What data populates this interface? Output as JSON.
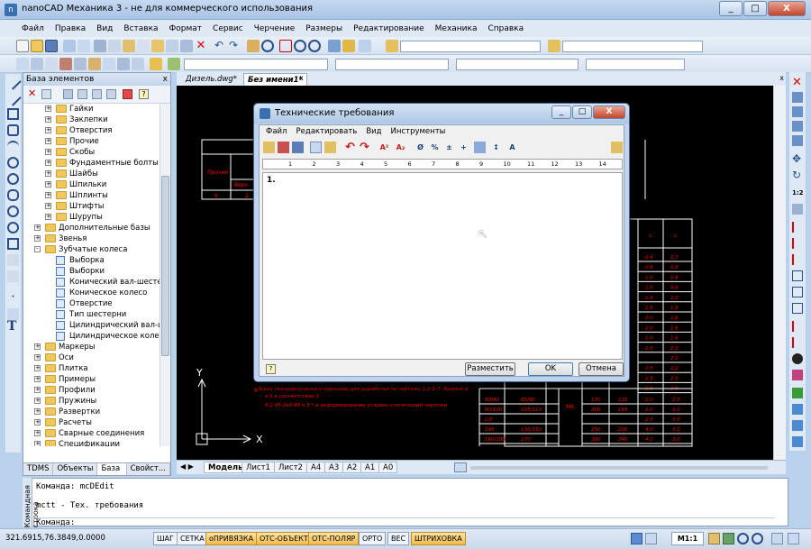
{
  "window": {
    "title": "nanoCAD Механика 3 - не для коммерческого использования",
    "min": "_",
    "max": "□",
    "close": "X"
  },
  "menu": [
    "Файл",
    "Правка",
    "Вид",
    "Вставка",
    "Формат",
    "Сервис",
    "Черчение",
    "Размеры",
    "Редактирование",
    "Механика",
    "Справка"
  ],
  "panel": {
    "title": "База элементов",
    "close": "x",
    "tree": [
      {
        "label": "Гайки",
        "level": 2,
        "type": "folder",
        "exp": "+"
      },
      {
        "label": "Заклепки",
        "level": 2,
        "type": "folder",
        "exp": "+"
      },
      {
        "label": "Отверстия",
        "level": 2,
        "type": "folder",
        "exp": "+"
      },
      {
        "label": "Прочие",
        "level": 2,
        "type": "folder",
        "exp": "+"
      },
      {
        "label": "Скобы",
        "level": 2,
        "type": "folder",
        "exp": "+"
      },
      {
        "label": "Фундаментные болты",
        "level": 2,
        "type": "folder",
        "exp": "+"
      },
      {
        "label": "Шайбы",
        "level": 2,
        "type": "folder",
        "exp": "+"
      },
      {
        "label": "Шпильки",
        "level": 2,
        "type": "folder",
        "exp": "+"
      },
      {
        "label": "Шплинты",
        "level": 2,
        "type": "folder",
        "exp": "+"
      },
      {
        "label": "Штифты",
        "level": 2,
        "type": "folder",
        "exp": "+"
      },
      {
        "label": "Шурупы",
        "level": 2,
        "type": "folder",
        "exp": "+"
      },
      {
        "label": "Дополнительные базы",
        "level": 1,
        "type": "folder",
        "exp": "+"
      },
      {
        "label": "Звенья",
        "level": 1,
        "type": "folder",
        "exp": "+"
      },
      {
        "label": "Зубчатые колеса",
        "level": 1,
        "type": "folder",
        "exp": "-"
      },
      {
        "label": "Выборка",
        "level": 2,
        "type": "doc",
        "exp": ""
      },
      {
        "label": "Выборки",
        "level": 2,
        "type": "doc",
        "exp": ""
      },
      {
        "label": "Конический вал-шестерн",
        "level": 2,
        "type": "doc",
        "exp": ""
      },
      {
        "label": "Коническое колесо",
        "level": 2,
        "type": "doc",
        "exp": ""
      },
      {
        "label": "Отверстие",
        "level": 2,
        "type": "doc",
        "exp": ""
      },
      {
        "label": "Тип шестерни",
        "level": 2,
        "type": "doc",
        "exp": ""
      },
      {
        "label": "Цилиндрический вал-шес",
        "level": 2,
        "type": "doc",
        "exp": ""
      },
      {
        "label": "Цилиндрическое колесо",
        "level": 2,
        "type": "doc",
        "exp": ""
      },
      {
        "label": "Маркеры",
        "level": 1,
        "type": "folder",
        "exp": "+"
      },
      {
        "label": "Оси",
        "level": 1,
        "type": "folder",
        "exp": "+"
      },
      {
        "label": "Плитка",
        "level": 1,
        "type": "folder",
        "exp": "+"
      },
      {
        "label": "Примеры",
        "level": 1,
        "type": "folder",
        "exp": "+"
      },
      {
        "label": "Профили",
        "level": 1,
        "type": "folder",
        "exp": "+"
      },
      {
        "label": "Пружины",
        "level": 1,
        "type": "folder",
        "exp": "+"
      },
      {
        "label": "Развертки",
        "level": 1,
        "type": "folder",
        "exp": "+"
      },
      {
        "label": "Расчеты",
        "level": 1,
        "type": "folder",
        "exp": "+"
      },
      {
        "label": "Сварные соединения",
        "level": 1,
        "type": "folder",
        "exp": "+"
      },
      {
        "label": "Спецификации",
        "level": 1,
        "type": "folder",
        "exp": "+"
      }
    ],
    "tabs": [
      "TDMS",
      "Объекты",
      "База эл...",
      "Свойст..."
    ]
  },
  "doc_tabs": [
    "Дизель.dwg*",
    "Без имени1*"
  ],
  "doc_tab_close": "x",
  "layout_tabs": [
    "Модель",
    "Лист1",
    "Лист2",
    "A4",
    "A3",
    "A2",
    "A1",
    "A0"
  ],
  "dialog": {
    "title": "Технические требования",
    "menu": [
      "Файл",
      "Редактировать",
      "Вид",
      "Инструменты"
    ],
    "ruler": [
      "1",
      "2",
      "3",
      "4",
      "5",
      "6",
      "7",
      "8",
      "9",
      "10",
      "11",
      "12",
      "13",
      "14"
    ],
    "editor_first_line": "1.",
    "buttons": {
      "place": "Разместить",
      "ok": "OK",
      "cancel": "Отмена"
    },
    "help_glyph": "?"
  },
  "command": {
    "side_label": "Командная строка",
    "lines": [
      "Команда: mcDEdit",
      "mctt - Тех. требования",
      "Команда:"
    ]
  },
  "status": {
    "coords": "321.6915,76.3849,0.0000",
    "toggles": [
      {
        "label": "ШАГ",
        "on": false
      },
      {
        "label": "СЕТКА",
        "on": false
      },
      {
        "label": "оПРИВЯЗКА",
        "on": true
      },
      {
        "label": "ОТС-ОБЪЕКТ",
        "on": true
      },
      {
        "label": "ОТС-ПОЛЯР",
        "on": true
      },
      {
        "label": "ОРТО",
        "on": false
      },
      {
        "label": "ВЕС",
        "on": false
      },
      {
        "label": "ШТРИХОВКА",
        "on": true
      }
    ],
    "scale": "M1:1"
  },
  "canvas": {
    "axis_x": "X",
    "axis_y": "Y",
    "note_lines": [
      "Эскиз технологического перехода для доработки по чертежу 1-2-1-7: Кромки и",
      "в 3 к соответствии 1",
      "В.2 45-2к9-98 п.5 * и деформирование условно статический чертежи"
    ],
    "table_a": [
      [
        "80/90",
        "85/95"
      ],
      [
        "90/100",
        "105/110"
      ],
      [
        "1/5",
        ""
      ],
      [
        "140",
        "130/150"
      ],
      [
        "160/180",
        "170"
      ]
    ],
    "table_b": [
      [
        "170",
        "130",
        "2.0",
        "2.5"
      ],
      [
        "200",
        "165",
        "2.0",
        "3.0"
      ],
      [
        "",
        "",
        "2.5",
        "3.0"
      ],
      [
        "250",
        "200",
        "4.0",
        "3.0"
      ],
      [
        "300",
        "240",
        "4.0",
        "3.0"
      ]
    ],
    "table_mid_label": "М6",
    "table_right_header": [
      "с",
      "с"
    ],
    "table_right_rows": [
      [
        "0.4",
        "0.7"
      ],
      [
        "0.6",
        "0.8"
      ],
      [
        "1.0",
        "0.8"
      ],
      [
        "1.0",
        "0.8"
      ],
      [
        "1.6",
        "1.0"
      ],
      [
        "1.6",
        "1.6"
      ],
      [
        "2.0",
        "1.6"
      ],
      [
        "2.0",
        "1.6"
      ],
      [
        "2.0",
        "1.6"
      ],
      [
        "2.0",
        "2.0"
      ],
      [
        "",
        "2.0"
      ],
      [
        "2.5",
        "2.0"
      ],
      [
        "2.5",
        "2.0"
      ],
      [
        "2.5",
        "2.0"
      ]
    ],
    "title_block_labels": [
      "Прочие",
      "Верх",
      "6",
      "2"
    ]
  }
}
